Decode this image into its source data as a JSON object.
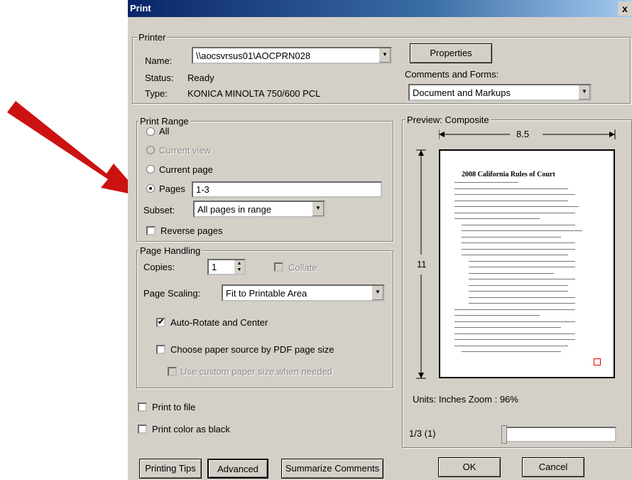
{
  "window": {
    "title": "Print",
    "close_glyph": "x"
  },
  "printer": {
    "legend": "Printer",
    "name_label": "Name:",
    "name_value": "\\\\aocsvrsus01\\AOCPRN028",
    "status_label": "Status:",
    "status_value": "Ready",
    "type_label": "Type:",
    "type_value": "KONICA MINOLTA 750/600 PCL",
    "properties_label": "Properties",
    "comments_label": "Comments and Forms:",
    "comments_value": "Document and Markups"
  },
  "print_range": {
    "legend": "Print Range",
    "all": "All",
    "current_view": "Current view",
    "current_page": "Current page",
    "pages": "Pages",
    "pages_value": "1-3",
    "subset_label": "Subset:",
    "subset_value": "All pages in range",
    "reverse_label": "Reverse pages",
    "selected": "pages"
  },
  "page_handling": {
    "legend": "Page Handling",
    "copies_label": "Copies:",
    "copies_value": "1",
    "collate_label": "Collate",
    "scaling_label": "Page Scaling:",
    "scaling_value": "Fit to Printable Area",
    "auto_rotate_label": "Auto-Rotate and Center",
    "auto_rotate_checked": true,
    "paper_source_label": "Choose paper source by PDF page size",
    "custom_paper_label": "Use custom paper size when needed"
  },
  "options": {
    "print_to_file": "Print to file",
    "print_color_black": "Print color as black"
  },
  "preview": {
    "legend": "Preview: Composite",
    "width_label": "8.5",
    "height_label": "11",
    "doc_title": "2008 California Rules of Court",
    "units_text": "Units: Inches  Zoom :  96%",
    "page_indicator": "1/3 (1)"
  },
  "buttons": {
    "printing_tips": "Printing Tips",
    "advanced": "Advanced",
    "summarize": "Summarize Comments",
    "ok": "OK",
    "cancel": "Cancel"
  },
  "colors": {
    "arrow": "#cc1111",
    "dialog_bg": "#d4d0c8"
  }
}
